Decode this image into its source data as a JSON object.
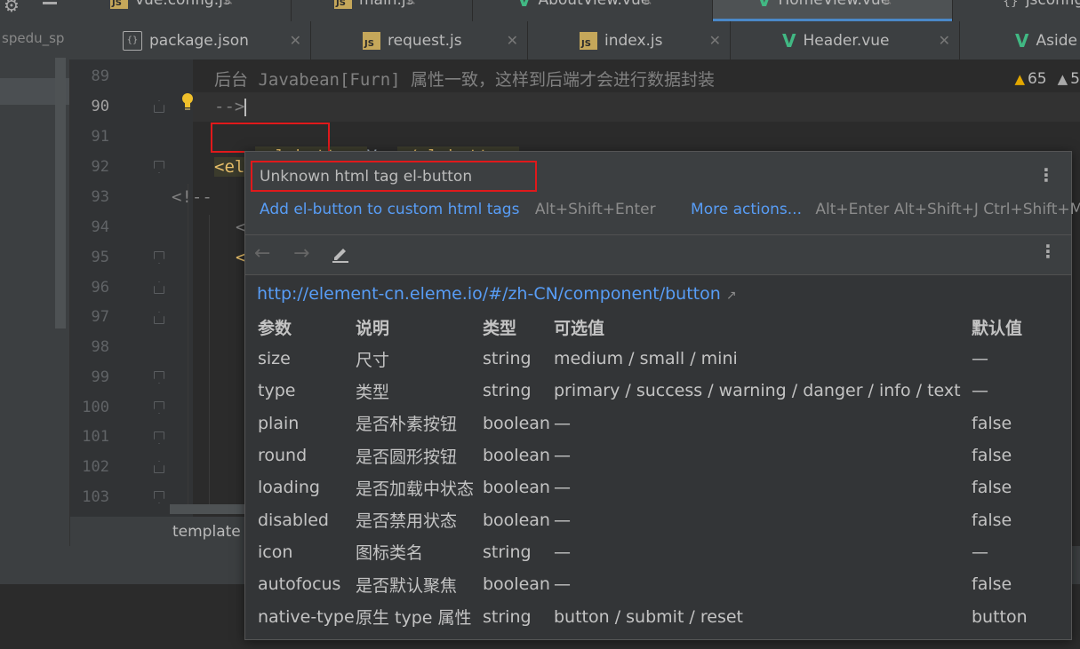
{
  "project": {
    "label": "spedu_sp"
  },
  "tabs_row1": [
    {
      "label": "vue.config.js",
      "type": "js"
    },
    {
      "label": "main.js",
      "type": "js"
    },
    {
      "label": "AboutView.vue",
      "type": "vue"
    },
    {
      "label": "HomeView.vue",
      "type": "vue",
      "active": true
    },
    {
      "label": "jsconfig",
      "type": "json"
    }
  ],
  "tabs_row2": [
    {
      "label": "package.json",
      "type": "json"
    },
    {
      "label": "request.js",
      "type": "js"
    },
    {
      "label": "index.js",
      "type": "js"
    },
    {
      "label": "Header.vue",
      "type": "vue"
    },
    {
      "label": "Aside",
      "type": "vue"
    }
  ],
  "line_numbers": [
    "89",
    "90",
    "91",
    "92",
    "93",
    "94",
    "95",
    "96",
    "97",
    "98",
    "99",
    "100",
    "101",
    "102",
    "103"
  ],
  "code": {
    "line89": "后台 Javabean[Furn] 属性一致，这样到后端才会进行数据封装",
    "line90": "-->",
    "line91_open": "<el-button>",
    "line91_text": "Vue",
    "line91_close": "</el-button>",
    "line92": "<el",
    "line93": "<!--",
    "line94": "<",
    "line95": "<"
  },
  "inspections": {
    "warnings": "65",
    "weak_warnings": "5"
  },
  "breadcrumb": "template",
  "popup": {
    "problem": "Unknown html tag el-button",
    "fix_label": "Add el-button to custom html tags",
    "fix_shortcut": "Alt+Shift+Enter",
    "more_label": "More actions...",
    "more_shortcut": "Alt+Enter Alt+Shift+J Ctrl+Shift+M",
    "doc_url": "http://element-cn.eleme.io/#/zh-CN/component/button",
    "table": {
      "headers": [
        "参数",
        "说明",
        "类型",
        "可选值",
        "默认值"
      ],
      "rows": [
        [
          "size",
          "尺寸",
          "string",
          "medium / small / mini",
          "—"
        ],
        [
          "type",
          "类型",
          "string",
          "primary / success / warning / danger / info / text",
          "—"
        ],
        [
          "plain",
          "是否朴素按钮",
          "boolean",
          "—",
          "false"
        ],
        [
          "round",
          "是否圆形按钮",
          "boolean",
          "—",
          "false"
        ],
        [
          "loading",
          "是否加载中状态",
          "boolean",
          "—",
          "false"
        ],
        [
          "disabled",
          "是否禁用状态",
          "boolean",
          "—",
          "false"
        ],
        [
          "icon",
          "图标类名",
          "string",
          "—",
          "—"
        ],
        [
          "autofocus",
          "是否默认聚焦",
          "boolean",
          "—",
          "false"
        ],
        [
          "native-type",
          "原生 type 属性",
          "string",
          "button / submit / reset",
          "button"
        ]
      ]
    }
  },
  "colors": {
    "accent": "#4a88c7",
    "link": "#589df6",
    "tag": "#e8bf6a",
    "highlight_box": "#e0191b",
    "warning": "#e2a700"
  }
}
